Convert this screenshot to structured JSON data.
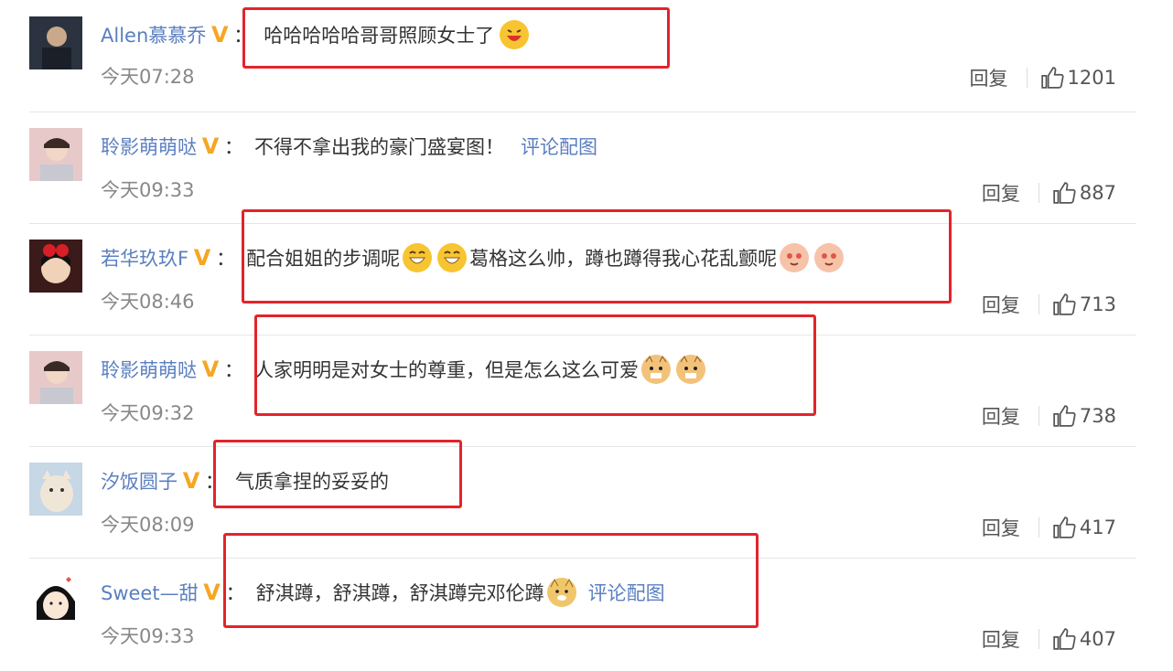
{
  "comments": [
    {
      "username": "Allen慕慕乔",
      "text": "哈哈哈哈哈哥哥照顾女士了",
      "time": "今天07:28",
      "reply": "回复",
      "likes": "1201",
      "link": ""
    },
    {
      "username": "聆影萌萌哒",
      "text": "不得不拿出我的豪门盛宴图！",
      "time": "今天09:33",
      "reply": "回复",
      "likes": "887",
      "link": "评论配图"
    },
    {
      "username": "若华玖玖F",
      "text_a": "配合姐姐的步调呢",
      "text_b": "葛格这么帅，蹲也蹲得我心花乱颤呢",
      "time": "今天08:46",
      "reply": "回复",
      "likes": "713",
      "link": ""
    },
    {
      "username": "聆影萌萌哒",
      "text": "人家明明是对女士的尊重，但是怎么这么可爱",
      "time": "今天09:32",
      "reply": "回复",
      "likes": "738",
      "link": ""
    },
    {
      "username": "汐饭圆子",
      "text": "气质拿捏的妥妥的",
      "time": "今天08:09",
      "reply": "回复",
      "likes": "417",
      "link": ""
    },
    {
      "username": "Sweet—甜",
      "text": "舒淇蹲，舒淇蹲，舒淇蹲完邓伦蹲",
      "time": "今天09:33",
      "reply": "回复",
      "likes": "407",
      "link": "评论配图"
    }
  ],
  "colon": "：",
  "colors": {
    "username": "#5a7fc0",
    "verified_badge": "#f5a623",
    "highlight_box": "#e3242b"
  },
  "icons": {
    "verified": "verified-v-icon",
    "like": "thumbs-up-icon"
  }
}
